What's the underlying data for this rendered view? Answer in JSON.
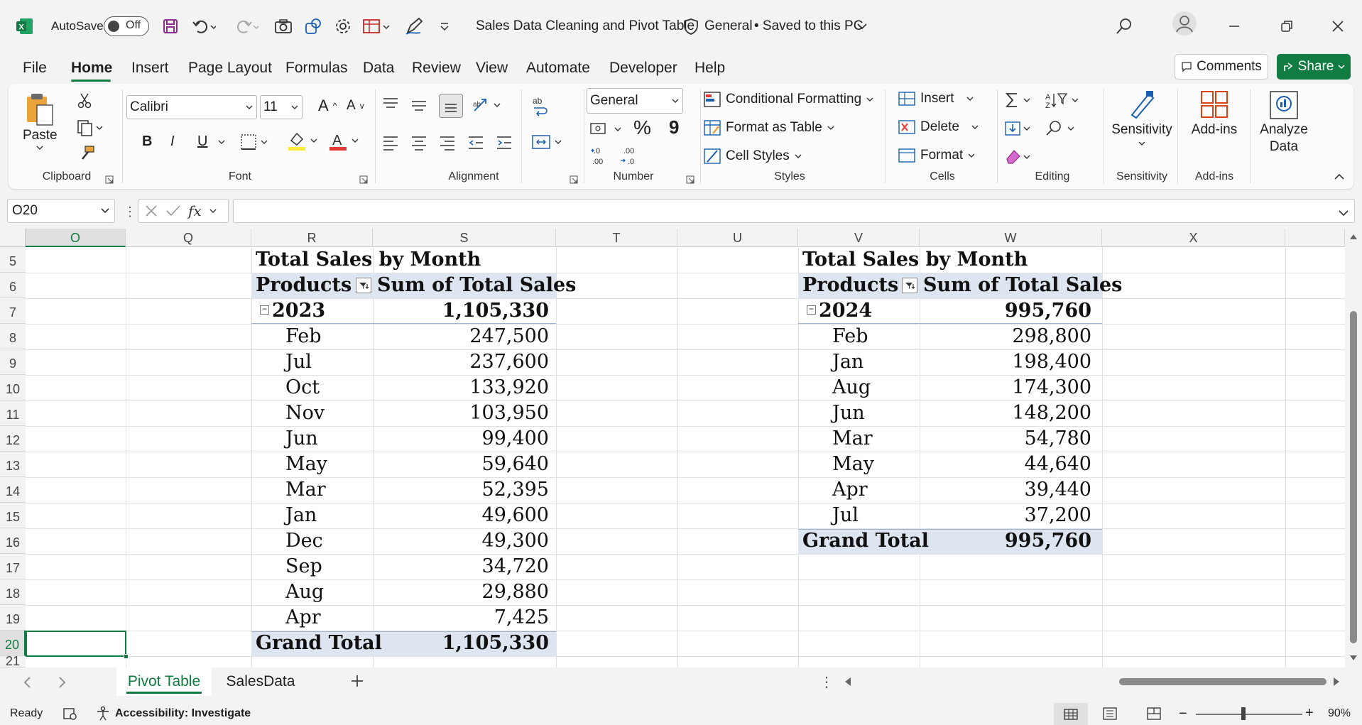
{
  "titlebar": {
    "autosave_label": "AutoSave",
    "autosave_state": "Off",
    "file_title": "Sales Data Cleaning and Pivot Table",
    "sensitivity": "General",
    "save_status": "• Saved to this PC"
  },
  "tabs": [
    "File",
    "Home",
    "Insert",
    "Page Layout",
    "Formulas",
    "Data",
    "Review",
    "View",
    "Automate",
    "Developer",
    "Help"
  ],
  "active_tab": "Home",
  "actions": {
    "comments": "Comments",
    "share": "Share"
  },
  "ribbon": {
    "clipboard": {
      "paste": "Paste",
      "label": "Clipboard"
    },
    "font": {
      "name": "Calibri",
      "size": "11",
      "label": "Font",
      "bold": "B",
      "italic": "I",
      "underline": "U"
    },
    "alignment": {
      "label": "Alignment"
    },
    "number": {
      "format": "General",
      "label": "Number",
      "percent": "%",
      "comma": "9"
    },
    "styles": {
      "conditional": "Conditional Formatting",
      "format_table": "Format as Table",
      "cell_styles": "Cell Styles",
      "label": "Styles"
    },
    "cells": {
      "insert": "Insert",
      "delete": "Delete",
      "format": "Format",
      "label": "Cells"
    },
    "editing": {
      "label": "Editing"
    },
    "sensitivity": {
      "button": "Sensitivity",
      "label": "Sensitivity"
    },
    "addins": {
      "button": "Add-ins",
      "label": "Add-ins"
    },
    "analyze": {
      "line1": "Analyze",
      "line2": "Data"
    }
  },
  "formula_bar": {
    "name_box": "O20",
    "fx": "fx",
    "formula": ""
  },
  "columns": [
    "O",
    "Q",
    "R",
    "S",
    "T",
    "U",
    "V",
    "W",
    "X"
  ],
  "rows": [
    "5",
    "6",
    "7",
    "8",
    "9",
    "10",
    "11",
    "12",
    "13",
    "14",
    "15",
    "16",
    "17",
    "18",
    "19",
    "20",
    "21"
  ],
  "pivot_left": {
    "title": "Total Sales by Month",
    "header_products": "Products",
    "header_sum": "Sum of Total Sales",
    "year": "2023",
    "year_total": "1,105,330",
    "rows": [
      {
        "month": "Feb",
        "value": "247,500"
      },
      {
        "month": "Jul",
        "value": "237,600"
      },
      {
        "month": "Oct",
        "value": "133,920"
      },
      {
        "month": "Nov",
        "value": "103,950"
      },
      {
        "month": "Jun",
        "value": "99,400"
      },
      {
        "month": "May",
        "value": "59,640"
      },
      {
        "month": "Mar",
        "value": "52,395"
      },
      {
        "month": "Jan",
        "value": "49,600"
      },
      {
        "month": "Dec",
        "value": "49,300"
      },
      {
        "month": "Sep",
        "value": "34,720"
      },
      {
        "month": "Aug",
        "value": "29,880"
      },
      {
        "month": "Apr",
        "value": "7,425"
      }
    ],
    "grand_label": "Grand Total",
    "grand_total": "1,105,330"
  },
  "pivot_right": {
    "title": "Total Sales by Month",
    "header_products": "Products",
    "header_sum": "Sum of Total Sales",
    "year": "2024",
    "year_total": "995,760",
    "rows": [
      {
        "month": "Feb",
        "value": "298,800"
      },
      {
        "month": "Jan",
        "value": "198,400"
      },
      {
        "month": "Aug",
        "value": "174,300"
      },
      {
        "month": "Jun",
        "value": "148,200"
      },
      {
        "month": "Mar",
        "value": "54,780"
      },
      {
        "month": "May",
        "value": "44,640"
      },
      {
        "month": "Apr",
        "value": "39,440"
      },
      {
        "month": "Jul",
        "value": "37,200"
      }
    ],
    "grand_label": "Grand Total",
    "grand_total": "995,760"
  },
  "sheets": [
    "Pivot Table",
    "SalesData"
  ],
  "active_sheet": "Pivot Table",
  "status": {
    "ready": "Ready",
    "accessibility": "Accessibility: Investigate",
    "zoom": "90%"
  },
  "colors": {
    "excel_green": "#107c41",
    "selection": "#107c41",
    "pivot_header_fill": "#dde6f0"
  }
}
